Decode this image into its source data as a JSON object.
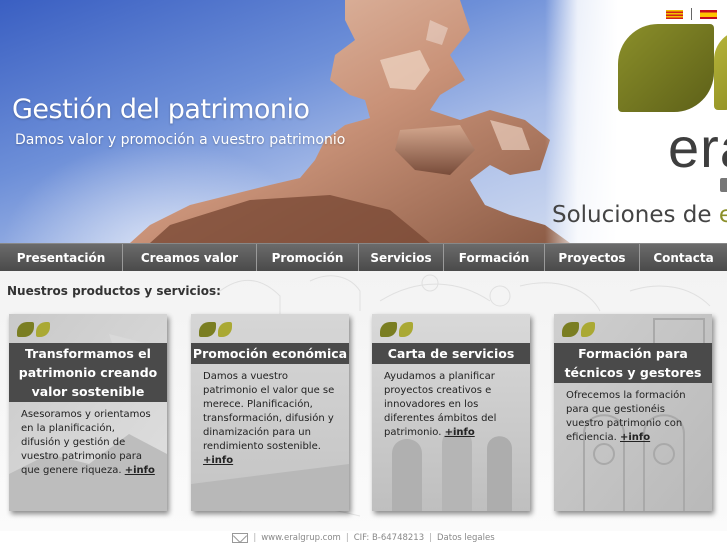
{
  "hero": {
    "title": "Gestión del patrimonio",
    "subtitle": "Damos valor y promoción a vuestro patrimonio"
  },
  "brand": {
    "wordmark": "era",
    "tagline_prefix": "Soluciones de ",
    "tagline_accent": "e",
    "colors": {
      "leaf_dark": "#7a7e22",
      "leaf_light": "#aaa934",
      "nav_bg": "#4a4a4a"
    }
  },
  "language_flags": [
    "catalan-flag-icon",
    "spanish-flag-icon"
  ],
  "nav": {
    "items": [
      "Presentación",
      "Creamos valor",
      "Promoción",
      "Servicios",
      "Formación",
      "Proyectos",
      "Contacta"
    ]
  },
  "main": {
    "heading": "Nuestros productos y servicios:",
    "cards": [
      {
        "title": "Transformamos el patrimonio creando valor sostenible",
        "body": "Asesoramos y orientamos en la planificación, difusión y gestión de vuestro patrimonio para que genere riqueza.",
        "more": "+info"
      },
      {
        "title": "Promoción económica",
        "body": "Damos a vuestro patrimonio el valor que se merece. Planificación, transformación, difusión y dinamización para un rendimiento sostenible.",
        "more": "+info"
      },
      {
        "title": "Carta de servicios",
        "body": "Ayudamos a planificar proyectos creativos e innovadores en los diferentes ámbitos del patrimonio.",
        "more": "+info"
      },
      {
        "title": "Formación para técnicos y gestores",
        "body": "Ofrecemos la formación para que gestionéis vuestro patrimonio con eficiencia.",
        "more": "+info"
      }
    ]
  },
  "footer": {
    "website": "www.eralgrup.com",
    "cif": "CIF: B-64748213",
    "legal": "Datos legales",
    "separator": "|"
  }
}
